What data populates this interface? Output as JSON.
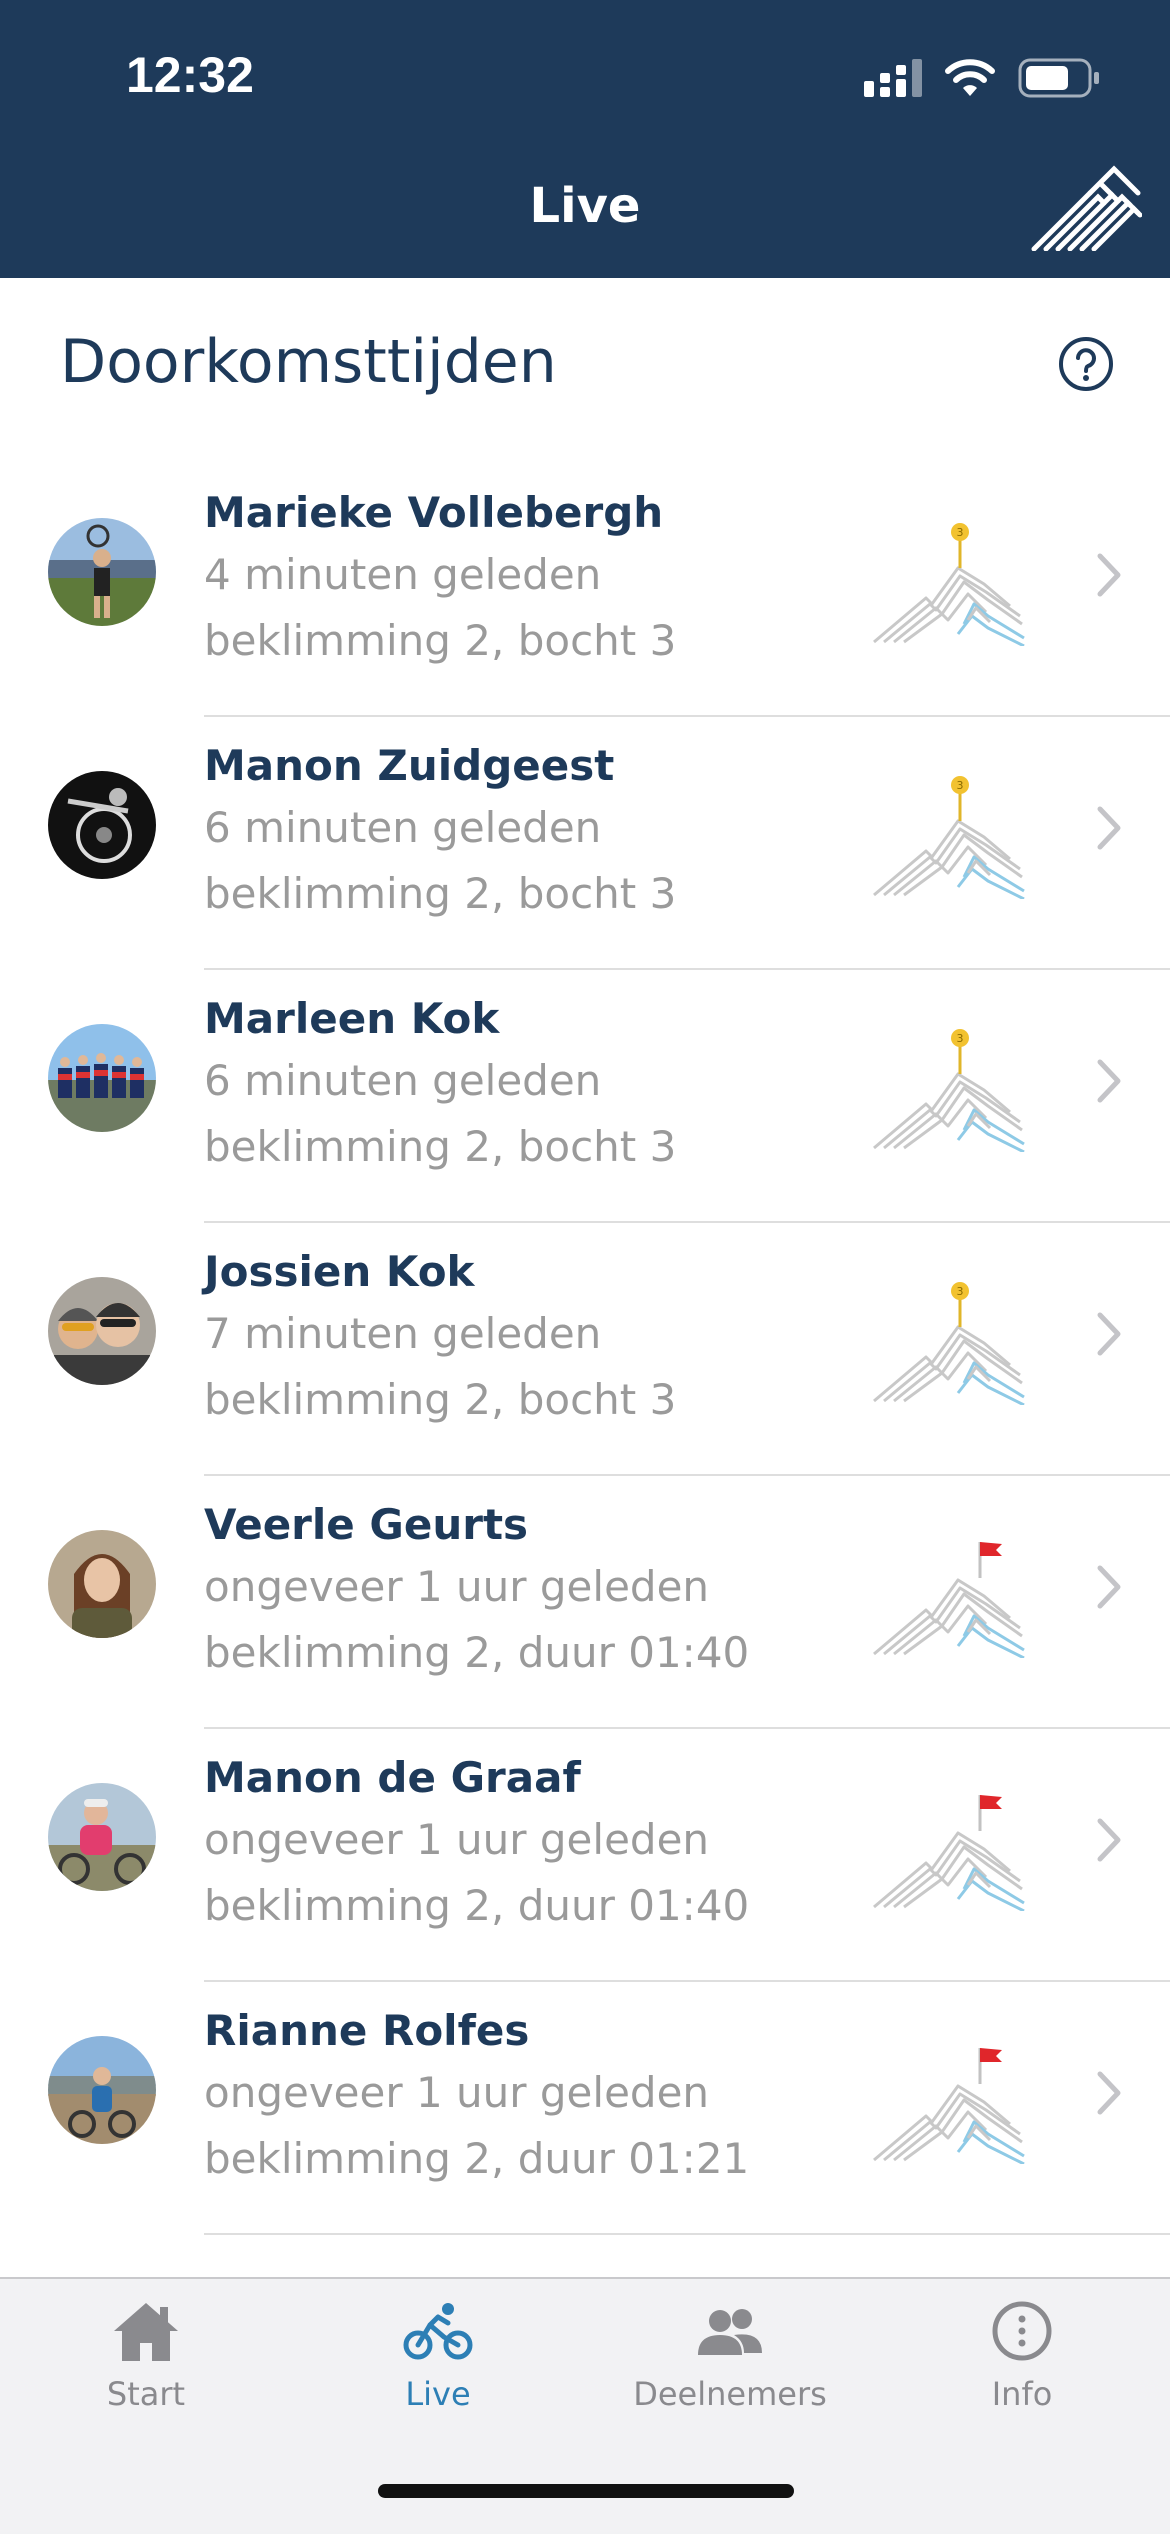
{
  "status_bar": {
    "time": "12:32"
  },
  "header": {
    "title": "Live"
  },
  "section": {
    "title": "Doorkomsttijden"
  },
  "passages": [
    {
      "name": "Marieke Vollebergh",
      "ago": "4 minuten geleden",
      "location": "beklimming 2, bocht 3",
      "marker": "3",
      "status": "bend"
    },
    {
      "name": "Manon Zuidgeest",
      "ago": "6 minuten geleden",
      "location": "beklimming 2, bocht 3",
      "marker": "3",
      "status": "bend"
    },
    {
      "name": "Marleen Kok",
      "ago": "6 minuten geleden",
      "location": "beklimming 2, bocht 3",
      "marker": "3",
      "status": "bend"
    },
    {
      "name": "Jossien Kok",
      "ago": "7 minuten geleden",
      "location": "beklimming 2, bocht 3",
      "marker": "3",
      "status": "bend"
    },
    {
      "name": "Veerle Geurts",
      "ago": "ongeveer 1 uur geleden",
      "location": "beklimming 2, duur 01:40",
      "status": "finished"
    },
    {
      "name": "Manon de Graaf",
      "ago": "ongeveer 1 uur geleden",
      "location": "beklimming 2, duur 01:40",
      "status": "finished"
    },
    {
      "name": "Rianne Rolfes",
      "ago": "ongeveer 1 uur geleden",
      "location": "beklimming 2, duur 01:21",
      "status": "finished"
    }
  ],
  "tabs": [
    {
      "label": "Start",
      "icon": "home-icon",
      "active": false
    },
    {
      "label": "Live",
      "icon": "bicycle-icon",
      "active": true
    },
    {
      "label": "Deelnemers",
      "icon": "people-icon",
      "active": false
    },
    {
      "label": "Info",
      "icon": "info-icon",
      "active": false
    }
  ],
  "colors": {
    "header": "#1e3a5a",
    "accent": "#2d7fb5",
    "marker_yellow": "#f2c230",
    "flag_red": "#e0262b",
    "secondary_text": "#9a9a9a"
  }
}
